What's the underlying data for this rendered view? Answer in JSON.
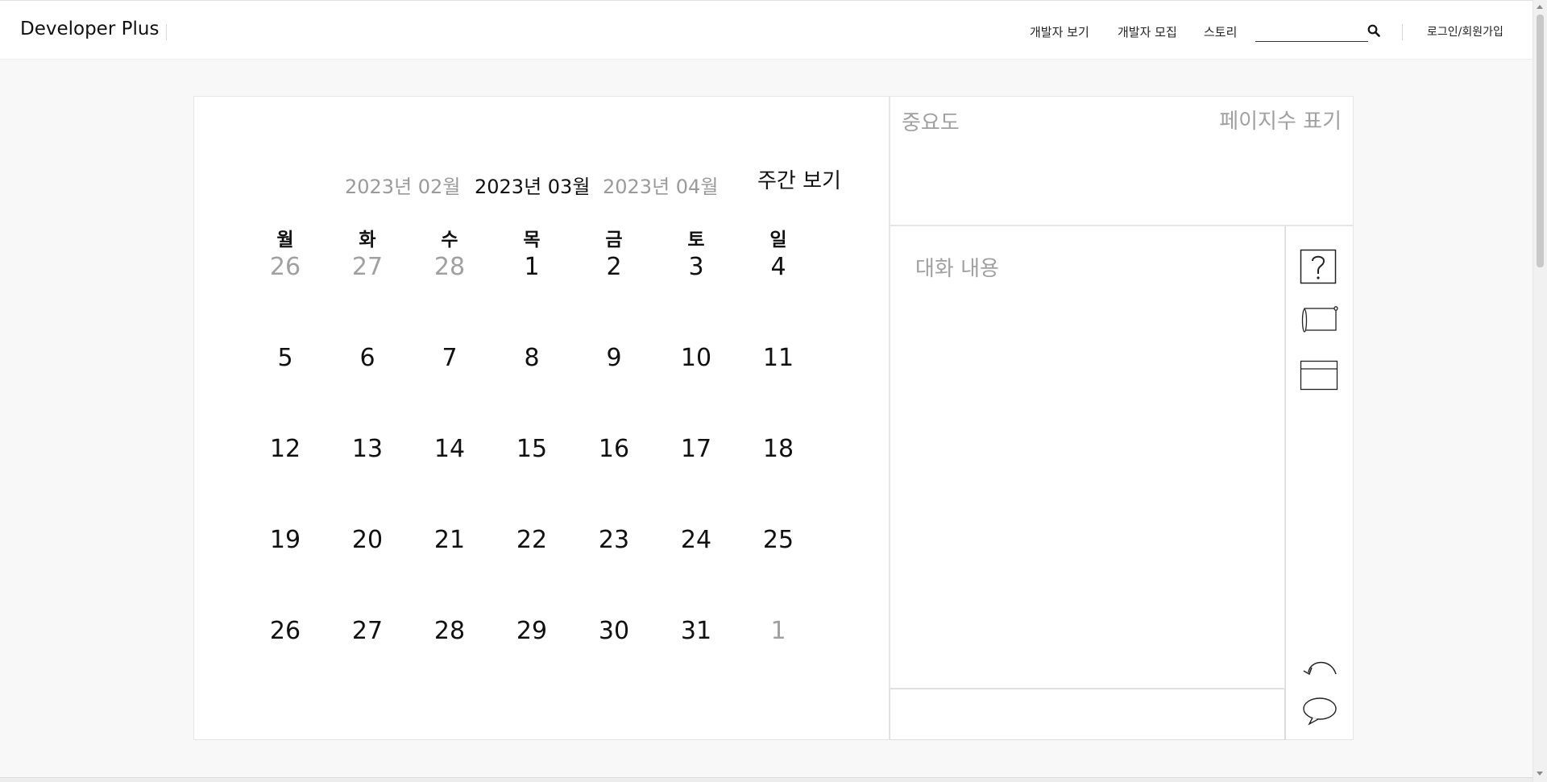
{
  "header": {
    "logo": "Developer Plus",
    "nav": [
      "개발자 보기",
      "개발자 모집",
      "스토리"
    ],
    "search_placeholder": "",
    "login": "로그인/회원가입"
  },
  "calendar": {
    "prev_month": "2023년 02월",
    "current_month": "2023년 03월",
    "next_month": "2023년 04월",
    "weekly_view": "주간 보기",
    "weekdays": [
      "월",
      "화",
      "수",
      "목",
      "금",
      "토",
      "일"
    ],
    "weeks": [
      [
        {
          "d": "26",
          "other": true
        },
        {
          "d": "27",
          "other": true
        },
        {
          "d": "28",
          "other": true
        },
        {
          "d": "1"
        },
        {
          "d": "2"
        },
        {
          "d": "3"
        },
        {
          "d": "4"
        }
      ],
      [
        {
          "d": "5"
        },
        {
          "d": "6"
        },
        {
          "d": "7"
        },
        {
          "d": "8"
        },
        {
          "d": "9"
        },
        {
          "d": "10"
        },
        {
          "d": "11"
        }
      ],
      [
        {
          "d": "12"
        },
        {
          "d": "13"
        },
        {
          "d": "14"
        },
        {
          "d": "15"
        },
        {
          "d": "16"
        },
        {
          "d": "17"
        },
        {
          "d": "18"
        }
      ],
      [
        {
          "d": "19"
        },
        {
          "d": "20"
        },
        {
          "d": "21"
        },
        {
          "d": "22"
        },
        {
          "d": "23"
        },
        {
          "d": "24"
        },
        {
          "d": "25"
        }
      ],
      [
        {
          "d": "26"
        },
        {
          "d": "27"
        },
        {
          "d": "28"
        },
        {
          "d": "29"
        },
        {
          "d": "30"
        },
        {
          "d": "31"
        },
        {
          "d": "1",
          "other": true
        }
      ]
    ]
  },
  "side": {
    "importance_label": "중요도",
    "page_count_label": "페이지수 표기",
    "chat_placeholder": "대화 내용"
  },
  "tools": [
    {
      "icon": "question-icon"
    },
    {
      "icon": "scroll-icon"
    },
    {
      "icon": "window-icon"
    },
    {
      "icon": "undo-icon"
    },
    {
      "icon": "speech-bubble-icon"
    }
  ],
  "colors": {
    "muted": "#a0a0a0",
    "text": "#111111",
    "page_bg": "#f8f8f8"
  }
}
